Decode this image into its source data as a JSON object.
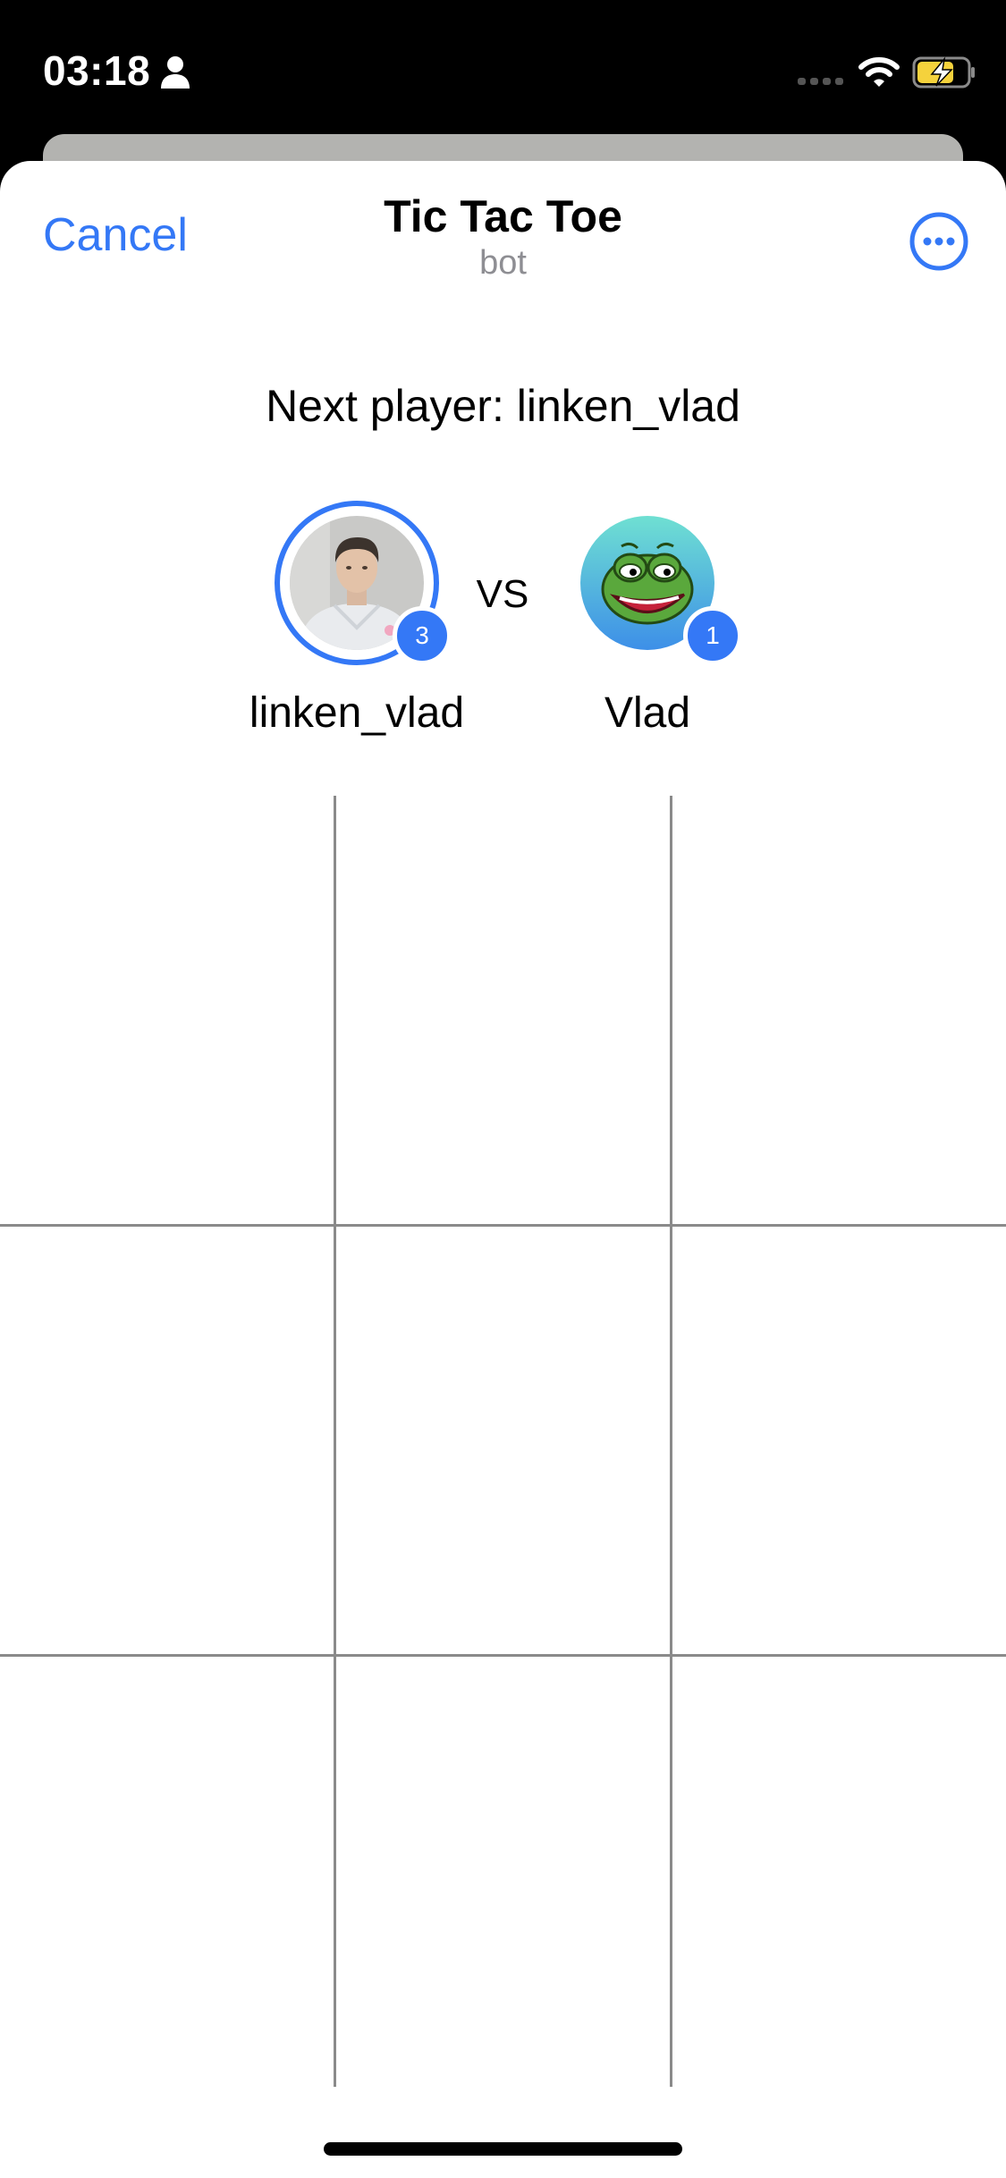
{
  "status_bar": {
    "time": "03:18",
    "icons": [
      "person-icon",
      "signal-icon",
      "wifi-icon",
      "battery-charging-icon"
    ],
    "battery_color": "#f5d23c"
  },
  "header": {
    "cancel_label": "Cancel",
    "title": "Tic Tac Toe",
    "subtitle": "bot",
    "more_icon": "ellipsis-circle-icon"
  },
  "game": {
    "next_player_text": "Next player: linken_vlad",
    "vs_label": "VS",
    "players": [
      {
        "name": "linken_vlad",
        "score": "3",
        "active": true
      },
      {
        "name": "Vlad",
        "score": "1",
        "active": false
      }
    ],
    "board": [
      [
        "",
        "",
        ""
      ],
      [
        "",
        "",
        ""
      ],
      [
        "",
        "",
        ""
      ]
    ]
  },
  "colors": {
    "accent": "#3478f6",
    "subtitle": "#8e8e93",
    "grid_line": "#8a8a8a"
  }
}
